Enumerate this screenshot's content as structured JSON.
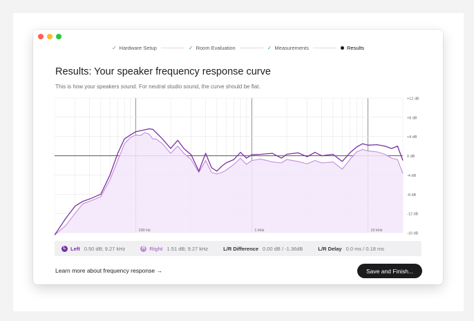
{
  "steps": [
    {
      "label": "Hardware Setup",
      "status": "done"
    },
    {
      "label": "Room Evaluation",
      "status": "done"
    },
    {
      "label": "Measurements",
      "status": "done"
    },
    {
      "label": "Results",
      "status": "current"
    }
  ],
  "page": {
    "title": "Results: Your speaker frequency response curve",
    "subtitle": "This is how your speakers sound. For neutral studio sound, the curve should be flat."
  },
  "stats": {
    "left": {
      "badge": "L",
      "label": "Left",
      "value": "0.50 dB; 9.27 kHz"
    },
    "right": {
      "badge": "R",
      "label": "Right",
      "value": "1.51 dB; 9.27 kHz"
    },
    "difference": {
      "label": "L/R Difference",
      "value": "0.00 dB / -1.36dB"
    },
    "delay": {
      "label": "L/R Delay",
      "value": "0.0 ms / 0.18 ms"
    }
  },
  "footer": {
    "learn_more": "Learn more about frequency response →",
    "save_label": "Save and Finish..."
  },
  "colors": {
    "left": "#7b2fa3",
    "right": "#c48bd8",
    "fill": "#f3e6fa",
    "grid": "#e6e6e6",
    "zero_line": "#555555"
  },
  "chart_data": {
    "type": "line",
    "x_scale": "log",
    "xlim": [
      20,
      20000
    ],
    "ylim": [
      -16,
      12
    ],
    "xticks": [
      {
        "value": 100,
        "label": "100 Hz"
      },
      {
        "value": 1000,
        "label": "1 kHz"
      },
      {
        "value": 10000,
        "label": "10 kHz"
      }
    ],
    "yticks": [
      {
        "value": 12,
        "label": "+12 dB"
      },
      {
        "value": 8,
        "label": "+8 dB"
      },
      {
        "value": 4,
        "label": "+4 dB"
      },
      {
        "value": 0,
        "label": "0 dB"
      },
      {
        "value": -4,
        "label": "-4 dB"
      },
      {
        "value": -8,
        "label": "-8 dB"
      },
      {
        "value": -12,
        "label": "-12 dB"
      },
      {
        "value": -16,
        "label": "-16 dB"
      }
    ],
    "grid": true,
    "series": [
      {
        "name": "Left",
        "x": [
          20,
          25,
          30,
          35,
          40,
          50,
          60,
          70,
          80,
          90,
          100,
          110,
          120,
          130,
          140,
          150,
          170,
          200,
          230,
          260,
          300,
          350,
          400,
          450,
          500,
          550,
          600,
          700,
          800,
          900,
          1000,
          1200,
          1500,
          1800,
          2000,
          2500,
          3000,
          3500,
          4000,
          5000,
          6000,
          7000,
          8000,
          9000,
          10000,
          12000,
          14000,
          16000,
          18000,
          20000
        ],
        "y": [
          -16.5,
          -13,
          -10.5,
          -9.5,
          -9,
          -8,
          -4,
          0.5,
          3.5,
          4.3,
          5,
          5.2,
          5.4,
          5.6,
          5.5,
          4.8,
          3.5,
          1.5,
          3.2,
          1.5,
          0.2,
          -3.2,
          0.5,
          -2.5,
          -3.2,
          -2.2,
          -1.5,
          -0.8,
          0.7,
          -0.5,
          0.2,
          0.3,
          0.5,
          -0.5,
          0.3,
          0.6,
          -0.2,
          0.7,
          0,
          0.3,
          -1.2,
          0.6,
          1.8,
          2.5,
          2.2,
          2.3,
          2.0,
          1.5,
          2.0,
          -1.0
        ]
      },
      {
        "name": "Right",
        "x": [
          20,
          25,
          30,
          35,
          40,
          50,
          60,
          70,
          80,
          90,
          100,
          110,
          120,
          130,
          140,
          150,
          170,
          200,
          230,
          260,
          300,
          350,
          400,
          450,
          500,
          550,
          600,
          700,
          800,
          900,
          1000,
          1200,
          1500,
          1800,
          2000,
          2500,
          3000,
          3500,
          4000,
          5000,
          6000,
          7000,
          8000,
          9000,
          10000,
          12000,
          14000,
          16000,
          18000,
          20000
        ],
        "y": [
          -16.5,
          -14.5,
          -12,
          -10,
          -9.5,
          -8.5,
          -5,
          -1,
          2.5,
          3.8,
          4.3,
          4.2,
          4.8,
          4.5,
          3.5,
          3.5,
          2.5,
          0.5,
          2,
          0.5,
          -0.8,
          -3.5,
          -1,
          -3.5,
          -3.8,
          -3.5,
          -3.0,
          -1.8,
          -0.5,
          -1.8,
          -1,
          -0.7,
          -1.3,
          -1.5,
          -0.8,
          -1.2,
          -1.7,
          -1.0,
          -1.5,
          -1.3,
          -2.8,
          -0.8,
          0.8,
          1.3,
          1.0,
          0.8,
          0.3,
          -0.5,
          -0.8,
          -3.7
        ]
      }
    ]
  }
}
